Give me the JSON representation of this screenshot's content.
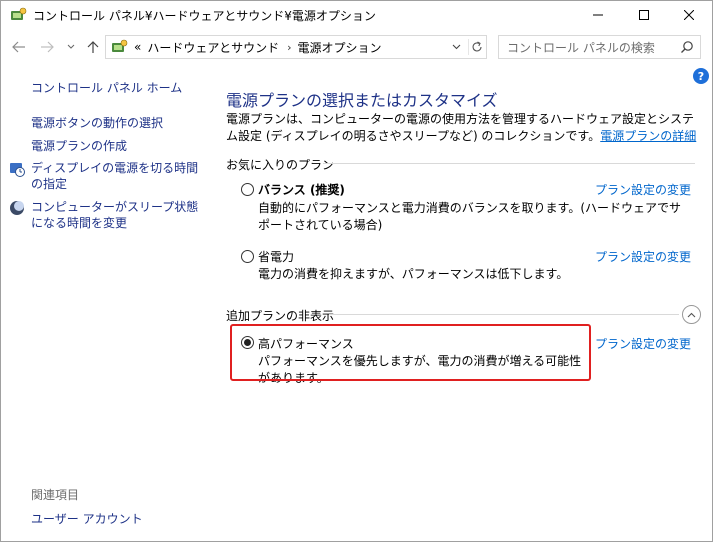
{
  "window": {
    "title": "コントロール パネル¥ハードウェアとサウンド¥電源オプション"
  },
  "address": {
    "overflow": "«",
    "crumbs": [
      "ハードウェアとサウンド",
      "電源オプション"
    ],
    "separator": "›"
  },
  "search": {
    "placeholder": "コントロール パネルの検索"
  },
  "sidebar": {
    "home": "コントロール パネル ホーム",
    "links": [
      "電源ボタンの動作の選択",
      "電源プランの作成",
      "ディスプレイの電源を切る時間の指定",
      "コンピューターがスリープ状態になる時間を変更"
    ],
    "related_heading": "関連項目",
    "related_link": "ユーザー アカウント"
  },
  "help": {
    "label": "?"
  },
  "main": {
    "title": "電源プランの選択またはカスタマイズ",
    "description": "電源プランは、コンピューターの電源の使用方法を管理するハードウェア設定とシステム設定 (ディスプレイの明るさやスリープなど) のコレクションです。",
    "description_link": "電源プランの詳細",
    "favorites_heading": "お気に入りのプラン",
    "hidden_heading": "追加プランの非表示",
    "change_link": "プラン設定の変更",
    "plans": [
      {
        "name": "バランス (推奨)",
        "description": "自動的にパフォーマンスと電力消費のバランスを取ります。(ハードウェアでサポートされている場合)",
        "selected": false
      },
      {
        "name": "省電力",
        "description": "電力の消費を抑えますが、パフォーマンスは低下します。",
        "selected": false
      },
      {
        "name": "高パフォーマンス",
        "description": "パフォーマンスを優先しますが、電力の消費が増える可能性があります。",
        "selected": true
      }
    ]
  },
  "icons": {
    "title": "power-options-icon",
    "back": "arrow-left-icon",
    "forward": "arrow-right-icon",
    "recent": "chevron-down-icon",
    "up": "arrow-up-icon",
    "refresh": "refresh-icon",
    "search": "search-icon",
    "display_timer": "clock-icon",
    "sleep": "moon-icon",
    "collapse": "chevron-up-icon"
  },
  "colors": {
    "link": "#0066cc",
    "heading": "#1e3287",
    "highlight": "#e02020",
    "help": "#1e6fd9"
  }
}
